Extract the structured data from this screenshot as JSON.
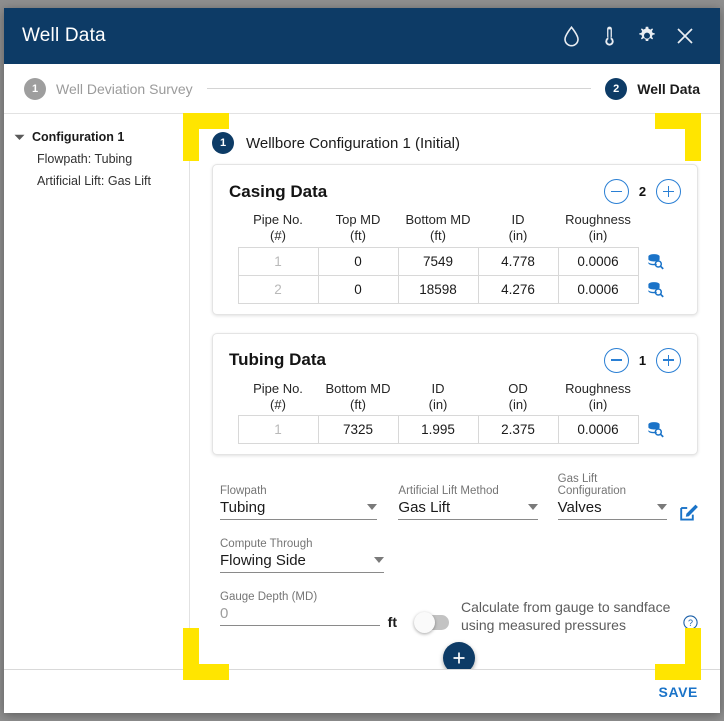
{
  "window": {
    "title": "Well Data",
    "icons": [
      {
        "name": "water-drop-icon",
        "label": "Fluid"
      },
      {
        "name": "thermometer-icon",
        "label": "Temperature"
      },
      {
        "name": "gear-icon",
        "label": "Settings"
      },
      {
        "name": "close-icon",
        "label": "Close"
      }
    ]
  },
  "stepper": {
    "steps": [
      {
        "number": "1",
        "label": "Well Deviation Survey",
        "state": "inactive"
      },
      {
        "number": "2",
        "label": "Well Data",
        "state": "active"
      }
    ]
  },
  "sidebar": {
    "config": {
      "title": "Configuration 1",
      "items": [
        {
          "label": "Flowpath: Tubing"
        },
        {
          "label": "Artificial Lift: Gas Lift"
        }
      ]
    }
  },
  "main": {
    "config_header": {
      "number": "1",
      "title": "Wellbore Configuration 1 (Initial)"
    },
    "casing": {
      "title": "Casing Data",
      "count": "2",
      "decrement_label": "−",
      "increment_label": "+",
      "columns": [
        {
          "name": "Pipe No.",
          "unit": "(#)"
        },
        {
          "name": "Top MD",
          "unit": "(ft)"
        },
        {
          "name": "Bottom MD",
          "unit": "(ft)"
        },
        {
          "name": "ID",
          "unit": "(in)"
        },
        {
          "name": "Roughness",
          "unit": "(in)"
        }
      ],
      "rows": [
        {
          "pipe_no": "1",
          "top_md": "0",
          "bottom_md": "7549",
          "id": "4.778",
          "roughness": "0.0006"
        },
        {
          "pipe_no": "2",
          "top_md": "0",
          "bottom_md": "18598",
          "id": "4.276",
          "roughness": "0.0006"
        }
      ]
    },
    "tubing": {
      "title": "Tubing Data",
      "count": "1",
      "decrement_label": "−",
      "increment_label": "+",
      "columns": [
        {
          "name": "Pipe No.",
          "unit": "(#)"
        },
        {
          "name": "Bottom MD",
          "unit": "(ft)"
        },
        {
          "name": "ID",
          "unit": "(in)"
        },
        {
          "name": "OD",
          "unit": "(in)"
        },
        {
          "name": "Roughness",
          "unit": "(in)"
        }
      ],
      "rows": [
        {
          "pipe_no": "1",
          "bottom_md": "7325",
          "id": "1.995",
          "od": "2.375",
          "roughness": "0.0006"
        }
      ]
    },
    "form": {
      "flowpath": {
        "label": "Flowpath",
        "value": "Tubing"
      },
      "artificial_lift_method": {
        "label": "Artificial Lift Method",
        "value": "Gas Lift"
      },
      "gas_lift_configuration": {
        "label": "Gas Lift Configuration",
        "value": "Valves"
      },
      "compute_through": {
        "label": "Compute Through",
        "value": "Flowing Side"
      },
      "gauge_depth": {
        "label": "Gauge Depth (MD)",
        "value": "0",
        "placeholder": "0",
        "unit": "ft"
      },
      "calculate_toggle": {
        "label": "Calculate from gauge to sandface using measured pressures",
        "state": "off"
      },
      "edit_icon": "edit-square-icon",
      "help_icon": "help-circle-icon"
    },
    "add_button_label": "+"
  },
  "footer": {
    "save_label": "SAVE"
  },
  "colors": {
    "brand_navy": "#0d3b66",
    "accent_blue": "#1a73c8",
    "highlight_yellow": "#ffe500",
    "muted_grey": "#9e9e9e"
  }
}
